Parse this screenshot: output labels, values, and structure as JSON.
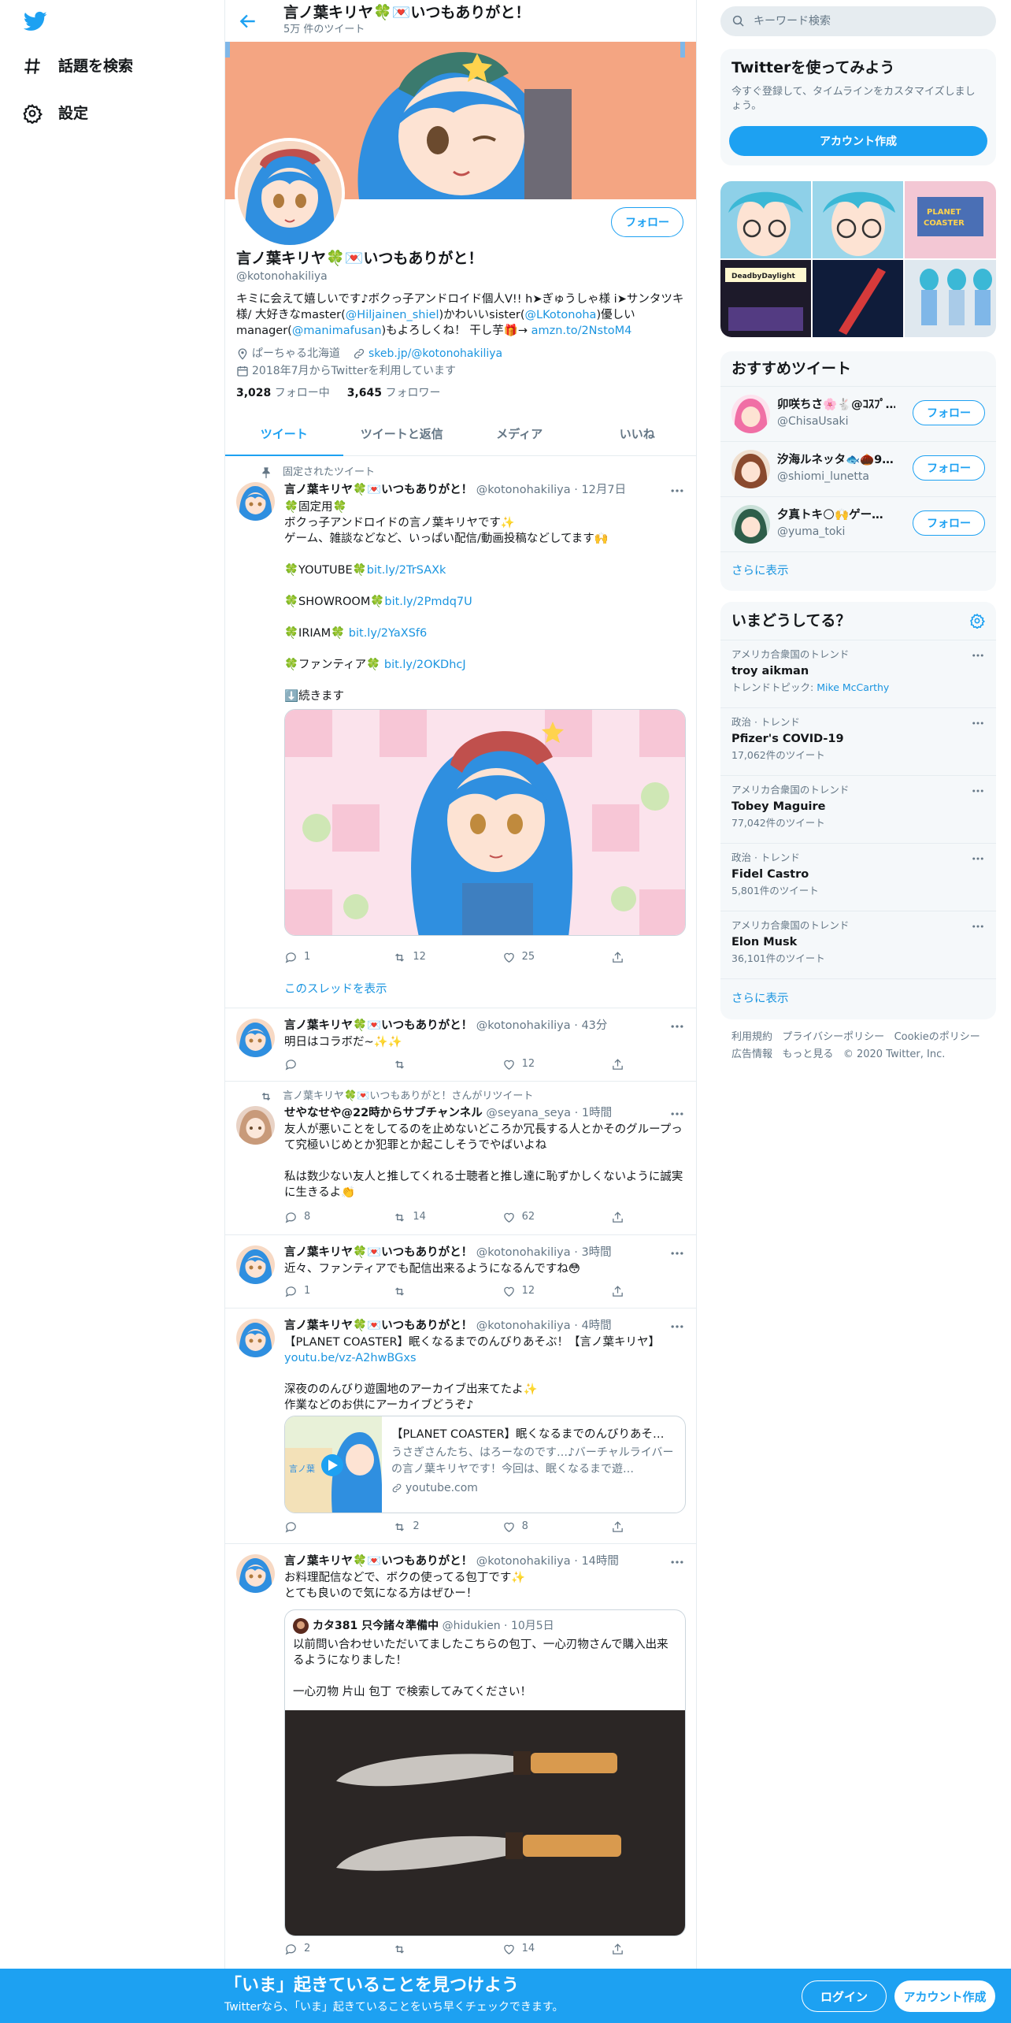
{
  "nav": {
    "explore_label": "話題を検索",
    "settings_label": "設定"
  },
  "header": {
    "title": "言ノ葉キリヤ🍀💌いつもありがと！",
    "tweet_count": "5万 件のツイート"
  },
  "profile": {
    "name": "言ノ葉キリヤ🍀💌いつもありがと！",
    "handle": "@kotonohakiliya",
    "follow_label": "フォロー",
    "bio_1": "キミに会えて嬉しいです♪ボクっ子アンドロイド個人V!! h➤ぎゅうしゃ様 i➤サンタツキ様/ 大好きなmaster(",
    "bio_m1": "@Hiljainen_shiel",
    "bio_2": ")かわいいsister(",
    "bio_m2": "@LKotonoha",
    "bio_3": ")優しいmanager(",
    "bio_m3": "@manimafusan",
    "bio_4": ")もよろしくね！ 干し芋🎁→ ",
    "bio_link": "amzn.to/2NstoM4",
    "location": "ぱーちゃる北海道",
    "url": "skeb.jp/@kotonohakiliya",
    "joined": "2018年7月からTwitterを利用しています",
    "following_count": "3,028",
    "following_label": "フォロー中",
    "followers_count": "3,645",
    "followers_label": "フォロワー"
  },
  "tabs": [
    "ツイート",
    "ツイートと返信",
    "メディア",
    "いいね"
  ],
  "pinned": {
    "context": "固定されたツイート",
    "name": "言ノ葉キリヤ🍀💌いつもありがと！",
    "handle": "@kotonohakiliya",
    "time": "12月7日",
    "text_1": "🍀固定用🍀\nボクっ子アンドロイドの言ノ葉キリヤです✨\nゲーム、雑談などなど、いっぱい配信/動画投稿などしてます🙌\n\n🍀YOUTUBE🍀",
    "link_1": "bit.ly/2TrSAXk",
    "text_2": "\n\n🍀SHOWROOM🍀",
    "link_2": "bit.ly/2Pmdq7U",
    "text_3": "\n\n🍀IRIAM🍀 ",
    "link_3": "bit.ly/2YaXSf6",
    "text_4": "\n\n🍀ファンティア🍀 ",
    "link_4": "bit.ly/2OKDhcJ",
    "text_5": "\n\n⬇️続きます",
    "replies": "1",
    "retweets": "12",
    "likes": "25",
    "thread_label": "このスレッドを表示"
  },
  "tweets": [
    {
      "name": "言ノ葉キリヤ🍀💌いつもありがと！",
      "handle": "@kotonohakiliya",
      "time": "43分",
      "text": "明日はコラボだ~✨✨",
      "replies": "",
      "retweets": "",
      "likes": "12"
    },
    {
      "context": "言ノ葉キリヤ🍀💌いつもありがと！さんがリツイート",
      "name": "せやなせや@22時からサブチャンネル",
      "handle": "@seyana_seya",
      "time": "1時間",
      "text": "友人が悪いことをしてるのを止めないどころか冗長する人とかそのグループって究極いじめとか犯罪とか起こしそうでやばいよね\n\n私は数少ない友人と推してくれる士聴者と推し達に恥ずかしくないように誠実に生きるよ👏",
      "replies": "8",
      "retweets": "14",
      "likes": "62"
    },
    {
      "name": "言ノ葉キリヤ🍀💌いつもありがと！",
      "handle": "@kotonohakiliya",
      "time": "3時間",
      "text": "近々、ファンティアでも配信出来るようになるんですね😳",
      "replies": "1",
      "retweets": "",
      "likes": "12"
    },
    {
      "name": "言ノ葉キリヤ🍀💌いつもありがと！",
      "handle": "@kotonohakiliya",
      "time": "4時間",
      "text_a": "【PLANET COASTER】眠くなるまでのんびりあそぶ！【言ノ葉キリヤ】\n",
      "link": "youtu.be/vz-A2hwBGxs",
      "text_b": "\n\n深夜ののんびり遊園地のアーカイブ出来てたよ✨\n作業などのお供にアーカイブどうぞ♪",
      "card_title": "【PLANET COASTER】眠くなるまでのんびりあそ…",
      "card_desc": "うさぎさんたち、はろーなのです…♪バーチャルライバーの言ノ葉キリヤです！今回は、眠くなるまで遊…",
      "card_domain": "youtube.com",
      "replies": "",
      "retweets": "2",
      "likes": "8"
    },
    {
      "name": "言ノ葉キリヤ🍀💌いつもありがと！",
      "handle": "@kotonohakiliya",
      "time": "14時間",
      "text": "お料理配信などで、ボクの使ってる包丁です✨\nとても良いので気になる方はぜひー！",
      "quote_name": "カタ381 只今諸々準備中",
      "quote_handle": "@hidukien",
      "quote_time": "10月5日",
      "quote_text": "以前問い合わせいただいてましたこちらの包丁、一心刃物さんで購入出来るようになりました！\n\n一心刃物 片山 包丁 で検索してみてください！",
      "replies": "2",
      "retweets": "",
      "likes": "14"
    }
  ],
  "search": {
    "placeholder": "キーワード検索"
  },
  "signup_card": {
    "title": "Twitterを使ってみよう",
    "subtitle": "今すぐ登録して、タイムラインをカスタマイズしましょう。",
    "button": "アカウント作成"
  },
  "recommended": {
    "title": "おすすめツイート",
    "users": [
      {
        "name": "卯咲ちさ🌸🐇@ｺｽﾌﾟ…",
        "handle": "@ChisaUsaki",
        "follow": "フォロー"
      },
      {
        "name": "汐海ルネッタ🐟🌰9…",
        "handle": "@shiomi_lunetta",
        "follow": "フォロー"
      },
      {
        "name": "夕真トキ🌕🙌ゲー…",
        "handle": "@yuma_toki",
        "follow": "フォロー"
      }
    ],
    "more": "さらに表示"
  },
  "trends": {
    "title": "いまどうしてる？",
    "items": [
      {
        "context": "アメリカ合衆国のトレンド",
        "name": "troy aikman",
        "extra_label": "トレンドトピック: ",
        "extra_link": "Mike McCarthy"
      },
      {
        "context": "政治 · トレンド",
        "name": "Pfizer's COVID-19",
        "count": "17,062件のツイート"
      },
      {
        "context": "アメリカ合衆国のトレンド",
        "name": "Tobey Maguire",
        "count": "77,042件のツイート"
      },
      {
        "context": "政治 · トレンド",
        "name": "Fidel Castro",
        "count": "5,801件のツイート"
      },
      {
        "context": "アメリカ合衆国のトレンド",
        "name": "Elon Musk",
        "count": "36,101件のツイート"
      }
    ],
    "more": "さらに表示"
  },
  "footer": {
    "terms": "利用規約",
    "privacy": "プライバシーポリシー",
    "cookie": "Cookieのポリシー",
    "ads": "広告情報",
    "more": "もっと見る",
    "copyright": "© 2020 Twitter, Inc."
  },
  "bottom_bar": {
    "title": "「いま」起きていることを見つけよう",
    "subtitle": "Twitterなら、「いま」起きていることをいち早くチェックできます。",
    "login": "ログイン",
    "signup": "アカウント作成"
  },
  "colors": {
    "accent": "#1da1f2",
    "link": "#1b95e0",
    "banner": "#f4a582",
    "text": "#14171a",
    "muted": "#657786"
  }
}
